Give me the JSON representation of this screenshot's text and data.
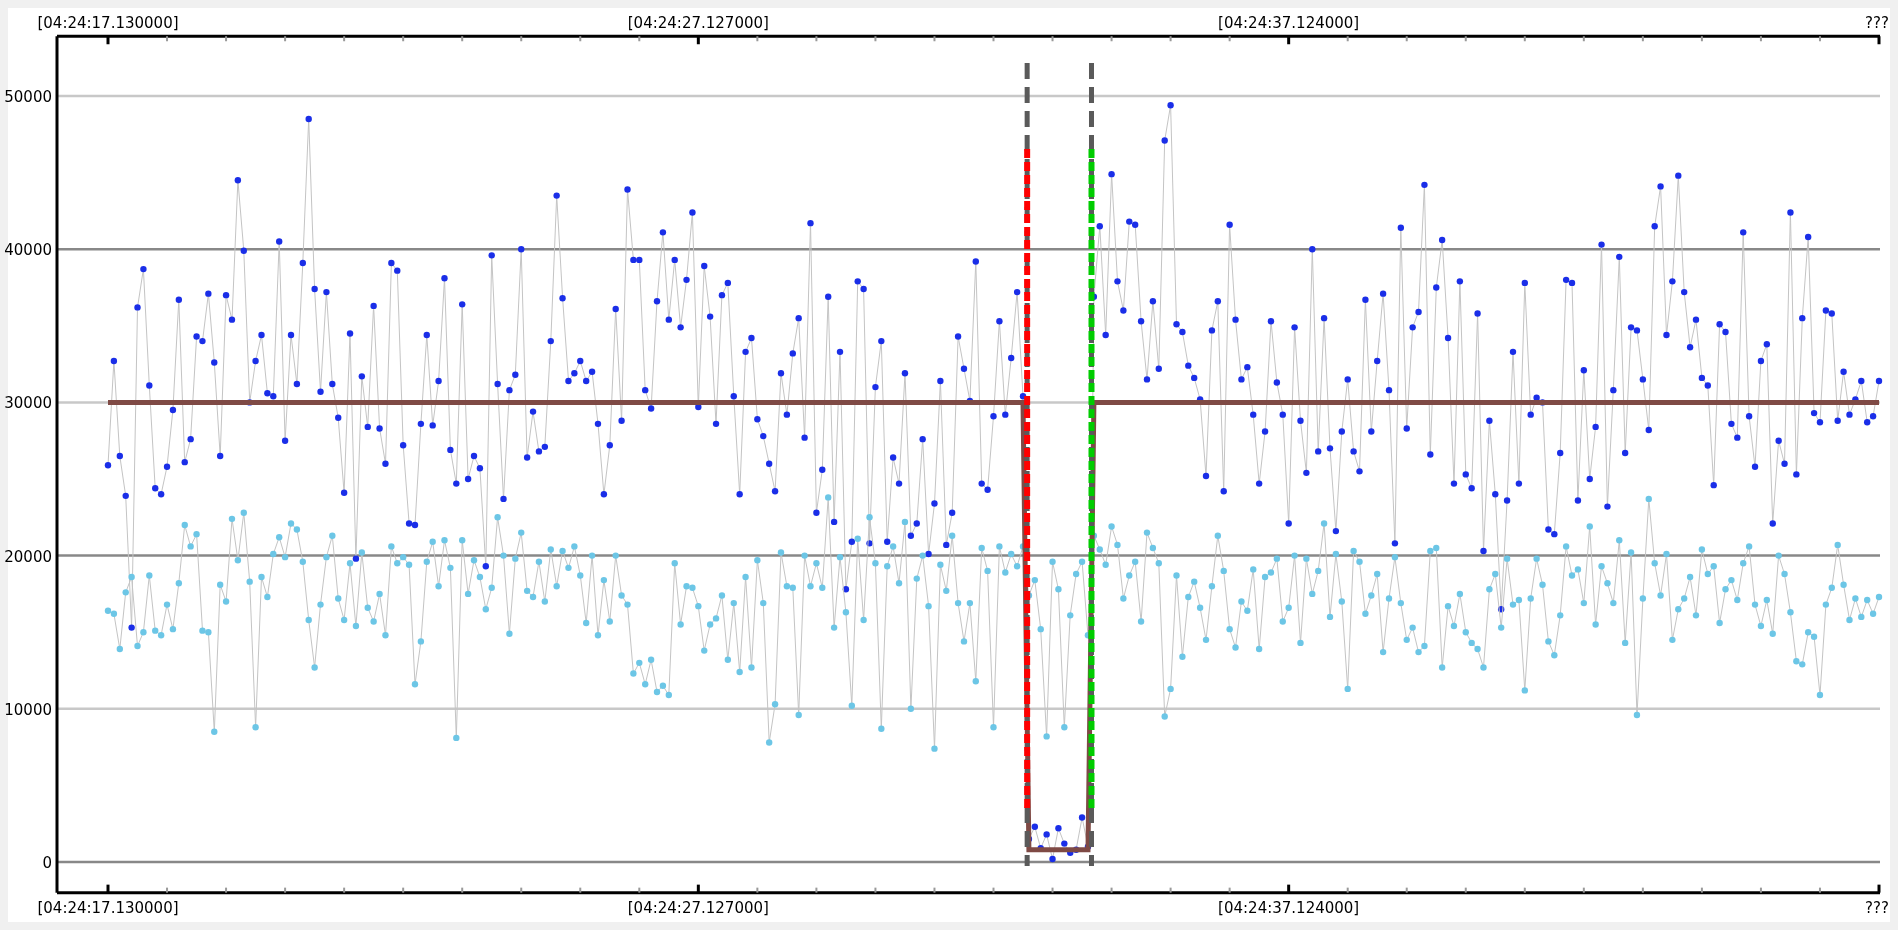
{
  "chart_data": {
    "type": "line",
    "grid": true,
    "ylim": [
      -2000,
      53900
    ],
    "categories": [
      "[04:24:17.130000]",
      null,
      null,
      null,
      null,
      null,
      null,
      null,
      null,
      null,
      null,
      null,
      null,
      null,
      null,
      null,
      null,
      null,
      null,
      null,
      null,
      null,
      null,
      null,
      null,
      null,
      null,
      null,
      null,
      null,
      null,
      null,
      null,
      null,
      null,
      null,
      null,
      null,
      null,
      null,
      null,
      null,
      null,
      null,
      null,
      null,
      null,
      null,
      null,
      null,
      null,
      null,
      null,
      null,
      null,
      null,
      null,
      null,
      null,
      null,
      null,
      null,
      null,
      null,
      null,
      null,
      null,
      null,
      null,
      null,
      null,
      null,
      null,
      null,
      null,
      null,
      null,
      null,
      null,
      null,
      null,
      null,
      null,
      null,
      null,
      null,
      null,
      null,
      null,
      null,
      null,
      null,
      null,
      null,
      null,
      null,
      null,
      null,
      null,
      null,
      "[04:24:27.127000]",
      null,
      null,
      null,
      null,
      null,
      null,
      null,
      null,
      null,
      null,
      null,
      null,
      null,
      null,
      null,
      null,
      null,
      null,
      null,
      null,
      null,
      null,
      null,
      null,
      null,
      null,
      null,
      null,
      null,
      null,
      null,
      null,
      null,
      null,
      null,
      null,
      null,
      null,
      null,
      null,
      null,
      null,
      null,
      null,
      null,
      null,
      null,
      null,
      null,
      null,
      null,
      null,
      null,
      null,
      null,
      null,
      null,
      null,
      null,
      null,
      null,
      null,
      null,
      null,
      null,
      null,
      null,
      null,
      null,
      null,
      null,
      null,
      null,
      null,
      null,
      null,
      null,
      null,
      null,
      null,
      null,
      null,
      null,
      null,
      null,
      null,
      null,
      null,
      null,
      null,
      null,
      null,
      null,
      null,
      null,
      null,
      null,
      null,
      null,
      "[04:24:37.124000]",
      null,
      null,
      null,
      null,
      null,
      null,
      null,
      null,
      null,
      null,
      null,
      null,
      null,
      null,
      null,
      null,
      null,
      null,
      null,
      null,
      null,
      null,
      null,
      null,
      null,
      null,
      null,
      null,
      null,
      null,
      null,
      null,
      null,
      null,
      null,
      null,
      null,
      null,
      null,
      null,
      null,
      null,
      null,
      null,
      null,
      null,
      null,
      null,
      null,
      null,
      null,
      null,
      null,
      null,
      null,
      null,
      null,
      null,
      null,
      null,
      null,
      null,
      null,
      null,
      null,
      null,
      null,
      null,
      null,
      null,
      null,
      null,
      null,
      null,
      null,
      null,
      null,
      null,
      null,
      null,
      null,
      null,
      null,
      null,
      null,
      null,
      null,
      null,
      null,
      null,
      null,
      null,
      null,
      null,
      null,
      null,
      null,
      null,
      null,
      "???"
    ],
    "yticks": [
      0,
      10000,
      20000,
      30000,
      40000,
      50000
    ],
    "series": [
      {
        "color": "#7f4a45",
        "values": [
          30000,
          30000,
          30000,
          30000,
          30000,
          30000,
          30000,
          30000,
          30000,
          30000,
          30000,
          30000,
          30000,
          30000,
          30000,
          30000,
          30000,
          30000,
          30000,
          30000,
          30000,
          30000,
          30000,
          30000,
          30000,
          30000,
          30000,
          30000,
          30000,
          30000,
          30000,
          30000,
          30000,
          30000,
          30000,
          30000,
          30000,
          30000,
          30000,
          30000,
          30000,
          30000,
          30000,
          30000,
          30000,
          30000,
          30000,
          30000,
          30000,
          30000,
          30000,
          30000,
          30000,
          30000,
          30000,
          30000,
          30000,
          30000,
          30000,
          30000,
          30000,
          30000,
          30000,
          30000,
          30000,
          30000,
          30000,
          30000,
          30000,
          30000,
          30000,
          30000,
          30000,
          30000,
          30000,
          30000,
          30000,
          30000,
          30000,
          30000,
          30000,
          30000,
          30000,
          30000,
          30000,
          30000,
          30000,
          30000,
          30000,
          30000,
          30000,
          30000,
          30000,
          30000,
          30000,
          30000,
          30000,
          30000,
          30000,
          30000,
          30000,
          30000,
          30000,
          30000,
          30000,
          30000,
          30000,
          30000,
          30000,
          30000,
          30000,
          30000,
          30000,
          30000,
          30000,
          30000,
          30000,
          30000,
          30000,
          30000,
          30000,
          30000,
          30000,
          30000,
          30000,
          30000,
          30000,
          30000,
          30000,
          30000,
          30000,
          30000,
          30000,
          30000,
          30000,
          30000,
          30000,
          30000,
          30000,
          30000,
          30000,
          30000,
          30000,
          30000,
          30000,
          30000,
          30000,
          30000,
          30000,
          30000,
          30000,
          30000,
          30000,
          30000,
          30000,
          30000,
          800,
          800,
          800,
          800,
          800,
          800,
          800,
          800,
          800,
          800,
          800,
          30000,
          30000,
          30000,
          30000,
          30000,
          30000,
          30000,
          30000,
          30000,
          30000,
          30000,
          30000,
          30000,
          30000,
          30000,
          30000,
          30000,
          30000,
          30000,
          30000,
          30000,
          30000,
          30000,
          30000,
          30000,
          30000,
          30000,
          30000,
          30000,
          30000,
          30000,
          30000,
          30000,
          30000,
          30000,
          30000,
          30000,
          30000,
          30000,
          30000,
          30000,
          30000,
          30000,
          30000,
          30000,
          30000,
          30000,
          30000,
          30000,
          30000,
          30000,
          30000,
          30000,
          30000,
          30000,
          30000,
          30000,
          30000,
          30000,
          30000,
          30000,
          30000,
          30000,
          30000,
          30000,
          30000,
          30000,
          30000,
          30000,
          30000,
          30000,
          30000,
          30000,
          30000,
          30000,
          30000,
          30000,
          30000,
          30000,
          30000,
          30000,
          30000,
          30000,
          30000,
          30000,
          30000,
          30000,
          30000,
          30000,
          30000,
          30000,
          30000,
          30000,
          30000,
          30000,
          30000,
          30000,
          30000,
          30000,
          30000,
          30000,
          30000,
          30000,
          30000,
          30000,
          30000,
          30000,
          30000,
          30000,
          30000,
          30000,
          30000,
          30000,
          30000,
          30000,
          30000,
          30000,
          30000,
          30000,
          30000,
          30000,
          30000,
          30000,
          30000,
          30000,
          30000,
          30000,
          30000,
          30000,
          30000,
          30000,
          30000,
          30000,
          30000
        ]
      },
      {
        "color": "#1a2ee8",
        "marker": "o",
        "values": [
          25900,
          32700,
          26500,
          23900,
          15300,
          36200,
          38700,
          31100,
          24400,
          24000,
          25800,
          29500,
          36700,
          26100,
          27600,
          34300,
          34000,
          37100,
          32600,
          26500,
          37000,
          35400,
          44500,
          39900,
          30000,
          32700,
          34400,
          30600,
          30400,
          40500,
          27500,
          34400,
          31200,
          39100,
          48500,
          37400,
          30700,
          37200,
          31200,
          29000,
          24100,
          34500,
          19800,
          31700,
          28400,
          36300,
          28300,
          26000,
          39100,
          38600,
          27200,
          22100,
          22000,
          28600,
          34400,
          28500,
          31400,
          38100,
          26900,
          24700,
          36400,
          25000,
          26500,
          25700,
          19300,
          39600,
          31200,
          23700,
          30800,
          31800,
          40000,
          26400,
          29400,
          26800,
          27100,
          34000,
          43500,
          36800,
          31400,
          31900,
          32700,
          31400,
          32000,
          28600,
          24000,
          27200,
          36100,
          28800,
          43900,
          39300,
          39300,
          30800,
          29600,
          36600,
          41100,
          35400,
          39300,
          34900,
          38000,
          42400,
          29700,
          38900,
          35600,
          28600,
          37000,
          37800,
          30400,
          24000,
          33300,
          34200,
          28900,
          27800,
          26000,
          24200,
          31900,
          29200,
          33200,
          35500,
          27700,
          41700,
          22800,
          25600,
          36900,
          22200,
          33300,
          17800,
          20900,
          37900,
          37400,
          20800,
          31000,
          34000,
          20900,
          26400,
          24700,
          31900,
          21300,
          22100,
          27600,
          20100,
          23400,
          31400,
          20700,
          22800,
          34300,
          32200,
          30100,
          39200,
          24700,
          24300,
          29100,
          35300,
          29200,
          32900,
          37200,
          30400,
          1500,
          2300,
          900,
          1800,
          200,
          2200,
          1200,
          600,
          800,
          2900,
          1000,
          36900,
          41500,
          34400,
          44900,
          37900,
          36000,
          41800,
          41600,
          35300,
          31500,
          36600,
          32200,
          47100,
          49400,
          35100,
          34600,
          32400,
          31600,
          30200,
          25200,
          34700,
          36600,
          24200,
          41600,
          35400,
          31500,
          32300,
          29200,
          24700,
          28100,
          35300,
          31300,
          29200,
          22100,
          34900,
          28800,
          25400,
          40000,
          26800,
          35500,
          27000,
          21600,
          28100,
          31500,
          26800,
          25500,
          36700,
          28100,
          32700,
          37100,
          30800,
          20800,
          41400,
          28300,
          34900,
          35900,
          44200,
          26600,
          37500,
          40600,
          34200,
          24700,
          37900,
          25300,
          24400,
          35800,
          20300,
          28800,
          24000,
          16500,
          23600,
          33300,
          24700,
          37800,
          29200,
          30300,
          30000,
          21700,
          21400,
          26700,
          38000,
          37800,
          23600,
          32100,
          25000,
          28400,
          40300,
          23200,
          30800,
          39500,
          26700,
          34900,
          34700,
          31500,
          28200,
          41500,
          44100,
          34400,
          37900,
          44800,
          37200,
          33600,
          35400,
          31600,
          31100,
          24600,
          35100,
          34600,
          28600,
          27700,
          41100,
          29100,
          25800,
          32700,
          33800,
          22100,
          27500,
          26000,
          42400,
          25300,
          35500,
          40800,
          29300,
          28700,
          36000,
          35800,
          28800,
          32000,
          29200,
          30200,
          31400,
          28700,
          29100,
          31400
        ]
      },
      {
        "color": "#6cc6e6",
        "marker": "o",
        "values": [
          16400,
          16200,
          13900,
          17600,
          18600,
          14100,
          15000,
          18700,
          15100,
          14800,
          16800,
          15200,
          18200,
          22000,
          20600,
          21400,
          15100,
          15000,
          8500,
          18100,
          17000,
          22400,
          19700,
          22800,
          18300,
          8800,
          18600,
          17300,
          20100,
          21200,
          19900,
          22100,
          21700,
          19600,
          15800,
          12700,
          16800,
          19900,
          21300,
          17200,
          15800,
          19500,
          15400,
          20200,
          16600,
          15700,
          17500,
          14800,
          20600,
          19500,
          19900,
          19400,
          11600,
          14400,
          19600,
          20900,
          18000,
          21000,
          19200,
          8100,
          21000,
          17500,
          19700,
          18600,
          16500,
          17900,
          22500,
          20000,
          14900,
          19800,
          21500,
          17700,
          17300,
          19600,
          17000,
          20400,
          18000,
          20300,
          19200,
          20600,
          18700,
          15600,
          20000,
          14800,
          18400,
          15700,
          20000,
          17400,
          16800,
          12300,
          13000,
          11600,
          13200,
          11100,
          11500,
          10900,
          19500,
          15500,
          18000,
          17900,
          16700,
          13800,
          15500,
          15900,
          17400,
          13200,
          16900,
          12400,
          18600,
          12700,
          19700,
          16900,
          7800,
          10300,
          20200,
          18000,
          17900,
          9600,
          20000,
          18000,
          19500,
          17900,
          23800,
          15300,
          19900,
          16300,
          10200,
          21100,
          15800,
          22500,
          19500,
          8700,
          19300,
          20600,
          18200,
          22200,
          10000,
          18500,
          20000,
          16700,
          7400,
          19400,
          17700,
          21300,
          16900,
          14400,
          16900,
          11800,
          20500,
          19000,
          8800,
          20600,
          18900,
          20100,
          19300,
          20600,
          17400,
          18400,
          15200,
          8200,
          19600,
          17800,
          8800,
          16100,
          18800,
          19600,
          14800,
          21300,
          20400,
          19400,
          21900,
          20700,
          17200,
          18700,
          19600,
          15700,
          21500,
          20500,
          19500,
          9500,
          11300,
          18700,
          13400,
          17300,
          18300,
          16600,
          14500,
          18000,
          21300,
          19000,
          15200,
          14000,
          17000,
          16400,
          19100,
          13900,
          18600,
          18900,
          19800,
          15700,
          16600,
          20000,
          14300,
          19800,
          17500,
          19000,
          22100,
          16000,
          20100,
          17000,
          11300,
          20300,
          19600,
          16200,
          17400,
          18800,
          13700,
          17200,
          19900,
          16900,
          14500,
          15300,
          13700,
          14100,
          20300,
          20500,
          12700,
          16700,
          15400,
          17500,
          15000,
          14300,
          13900,
          12700,
          17800,
          18800,
          15300,
          19800,
          16800,
          17100,
          11200,
          17200,
          19800,
          18100,
          14400,
          13500,
          16100,
          20600,
          18700,
          19100,
          16900,
          21900,
          15500,
          19300,
          18200,
          16900,
          21000,
          14300,
          20200,
          9600,
          17200,
          23700,
          19500,
          17400,
          20100,
          14500,
          16500,
          17200,
          18600,
          16100,
          20400,
          18800,
          19300,
          15600,
          17800,
          18400,
          17100,
          19500,
          20600,
          16800,
          15400,
          17100,
          14900,
          20000,
          18800,
          16300,
          13100,
          12900,
          15000,
          14700,
          10900,
          16800,
          17900,
          20700,
          18100,
          15800,
          17200,
          16000,
          17100,
          16200,
          17300
        ]
      }
    ]
  }
}
